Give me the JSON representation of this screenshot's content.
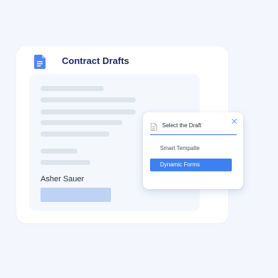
{
  "card": {
    "title": "Contract Drafts",
    "signer_name": "Asher Sauer"
  },
  "icons": {
    "document": "document-icon",
    "close": "close-icon",
    "file": "file-icon"
  },
  "popup": {
    "title": "Select the Draft",
    "options": [
      {
        "label": "Smart Tempalte",
        "selected": false
      },
      {
        "label": "Dynamic Forms",
        "selected": true
      }
    ]
  },
  "colors": {
    "background": "#f3f7fd",
    "title_text": "#1b2a6b",
    "document_icon": "#4f86ec",
    "accent": "#3b82f0",
    "signature_field": "#bed2f4",
    "skeleton": "#dfe3ea"
  }
}
